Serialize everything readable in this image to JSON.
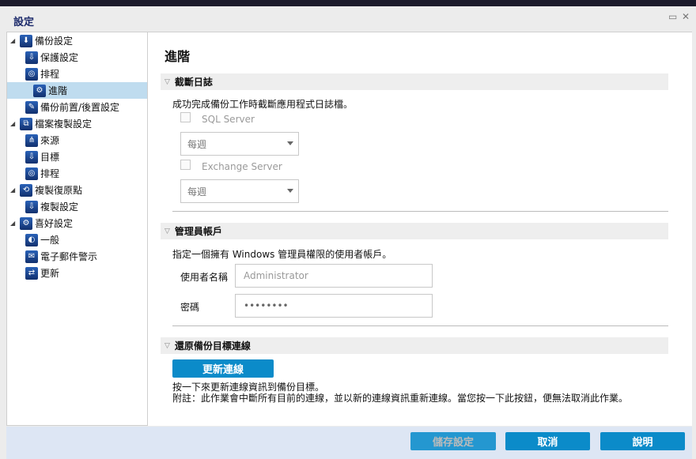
{
  "window": {
    "title": "設定",
    "restore_icon": "▭",
    "close_icon": "✕"
  },
  "sidebar": {
    "items": [
      {
        "label": "備份設定",
        "level": 0
      },
      {
        "label": "保護設定",
        "level": 1
      },
      {
        "label": "排程",
        "level": 1
      },
      {
        "label": "進階",
        "level": 1,
        "selected": true
      },
      {
        "label": "備份前置/後置設定",
        "level": 1
      },
      {
        "label": "檔案複製設定",
        "level": 0
      },
      {
        "label": "來源",
        "level": 1
      },
      {
        "label": "目標",
        "level": 1
      },
      {
        "label": "排程",
        "level": 1
      },
      {
        "label": "複製復原點",
        "level": 0
      },
      {
        "label": "複製設定",
        "level": 1
      },
      {
        "label": "喜好設定",
        "level": 0
      },
      {
        "label": "一般",
        "level": 1
      },
      {
        "label": "電子郵件警示",
        "level": 1
      },
      {
        "label": "更新",
        "level": 1
      }
    ]
  },
  "main": {
    "title": "進階",
    "truncate": {
      "header": "截斷日誌",
      "desc": "成功完成備份工作時截斷應用程式日誌檔。",
      "sql_label": "SQL Server",
      "sql_freq": "每週",
      "exchange_label": "Exchange Server",
      "exchange_freq": "每週"
    },
    "admin": {
      "header": "管理員帳戶",
      "desc": "指定一個擁有 Windows 管理員權限的使用者帳戶。",
      "username_label": "使用者名稱",
      "username_value": "Administrator",
      "password_label": "密碼",
      "password_value": "••••••••"
    },
    "restore": {
      "header": "還原備份目標連線",
      "button": "更新連線",
      "desc1": "按一下來更新連線資訊到備份目標。",
      "desc2": "附註：此作業會中斷所有目前的連線，並以新的連線資訊重新連線。當您按一下此按鈕，便無法取消此作業。"
    }
  },
  "footer": {
    "save": "儲存設定",
    "cancel": "取消",
    "help": "說明"
  }
}
